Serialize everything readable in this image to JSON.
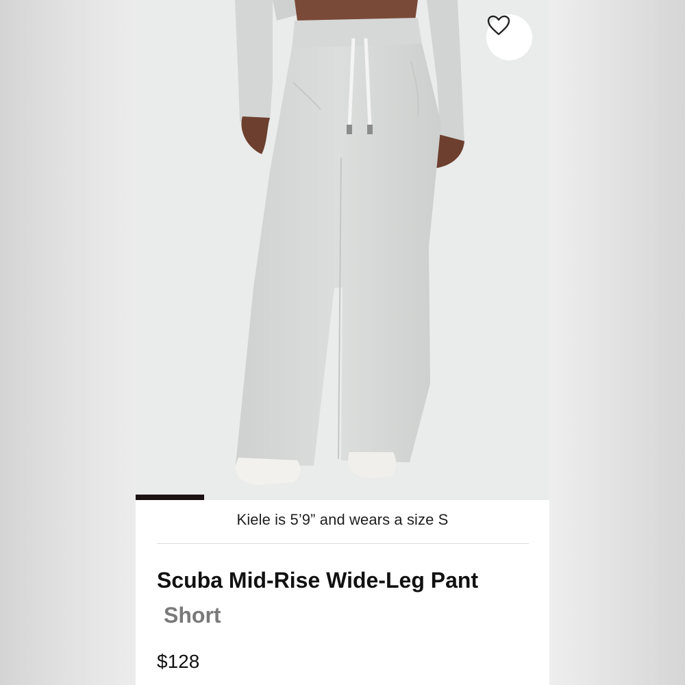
{
  "product": {
    "name": "Scuba Mid-Rise Wide-Leg Pant",
    "variant": "Short",
    "price": "$128",
    "model_note": "Kiele is 5’9” and wears a size S"
  },
  "image": {
    "description_icon": "favorite-heart-icon",
    "gallery_progress": 0.166
  },
  "colors": {
    "accent": "#1c1214",
    "fabric": "#d3d5d4",
    "background": "#eaebeb"
  }
}
